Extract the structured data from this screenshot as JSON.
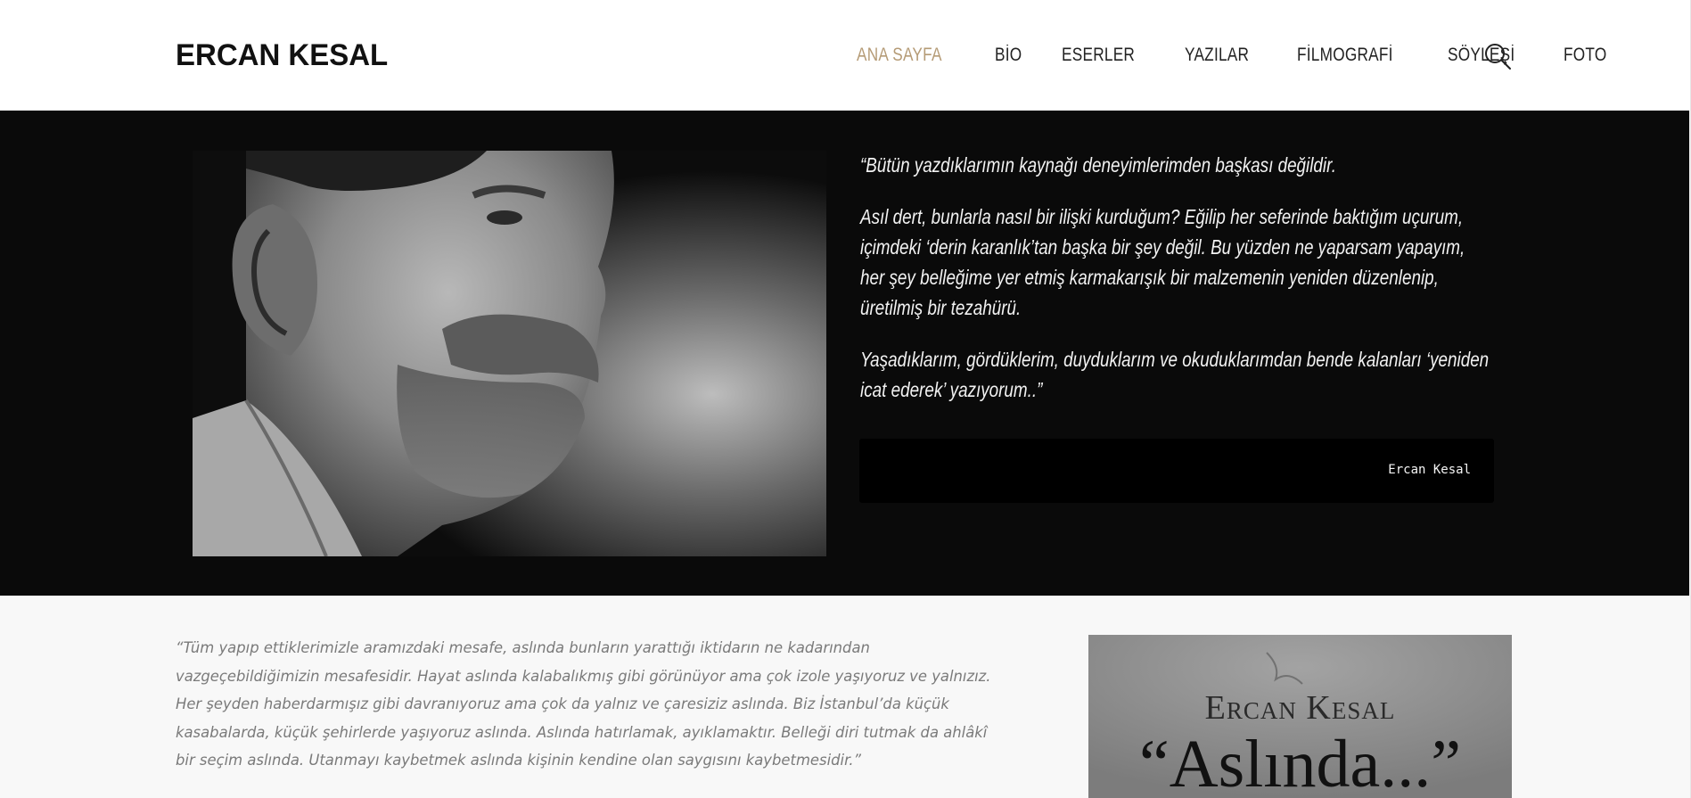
{
  "header": {
    "logo": "ERCAN KESAL",
    "nav": [
      {
        "label": "ANA SAYFA",
        "active": true
      },
      {
        "label": "BİO"
      },
      {
        "label": "ESERLER"
      },
      {
        "label": "YAZILAR"
      },
      {
        "label": "FİLMOGRAFİ"
      },
      {
        "label": "SÖYLEŞİ"
      },
      {
        "label": "FOTO"
      }
    ],
    "search_icon": "search-icon",
    "accent_color": "#b59b76"
  },
  "hero": {
    "quote_paragraphs": [
      "“Bütün yazdıklarımın kaynağı deneyimlerimden başkası değildir.",
      "Asıl dert, bunlarla nasıl bir ilişki kurduğum? Eğilip her seferinde baktığım uçurum, içimdeki ‘derin karanlık’tan başka bir şey değil. Bu yüzden ne yaparsam yapayım, her şey belleğime yer etmiş karmakarışık bir malzemenin yeniden düzenlenip, üretilmiş bir tezahürü.",
      "Yaşadıklarım, gördüklerim, duyduklarım ve okuduklarımdan bende kalanları ‘yeniden icat ederek’ yazıyorum..”"
    ],
    "author": "Ercan Kesal"
  },
  "lower": {
    "quote_lines": [
      "“Tüm yapıp ettiklerimizle aramızdaki mesafe, aslında bunların yarattığı iktidarın ne kadarından",
      "vazgeçebildiğimizin mesafesidir. Hayat aslında kalabalıkmış gibi görünüyor ama çok izole yaşıyoruz ve yalnızız.",
      "Her şeyden haberdarmışız gibi davranıyoruz ama çok da yalnız ve çaresiziz aslında. Biz İstanbul’da küçük",
      "kasabalarda, küçük şehirlerde yaşıyoruz aslında. Aslında hatırlamak, ayıklamaktır. Belleği diri tutmak da ahlâkî",
      "bir seçim aslında. Utanmayı kaybetmek aslında kişinin kendine olan saygısını kaybetmesidir.”"
    ],
    "book": {
      "author": "Ercan Kesal",
      "title": "“Aslında...”"
    }
  }
}
